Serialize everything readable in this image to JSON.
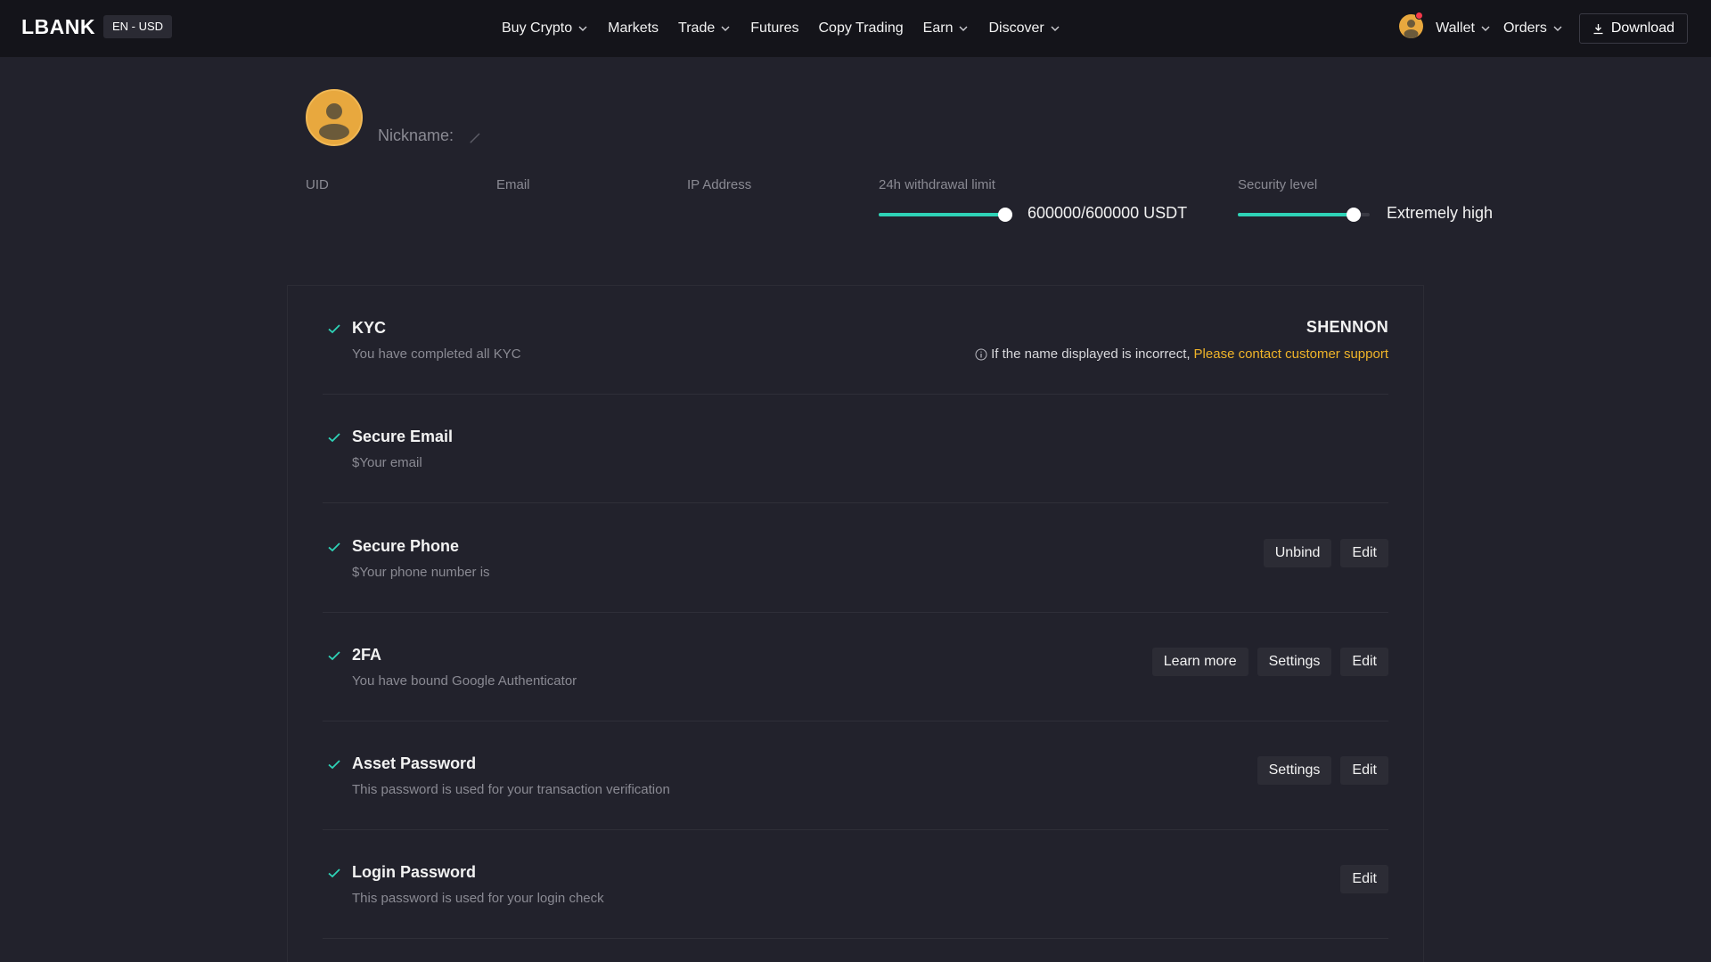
{
  "nav": {
    "logo": "LBANK",
    "lang_currency": "EN - USD",
    "items": [
      {
        "label": "Buy Crypto",
        "dropdown": true
      },
      {
        "label": "Markets",
        "dropdown": false
      },
      {
        "label": "Trade",
        "dropdown": true
      },
      {
        "label": "Futures",
        "dropdown": false
      },
      {
        "label": "Copy Trading",
        "dropdown": false
      },
      {
        "label": "Earn",
        "dropdown": true
      },
      {
        "label": "Discover",
        "dropdown": true
      }
    ],
    "wallet": "Wallet",
    "orders": "Orders",
    "download": "Download"
  },
  "profile": {
    "nickname_label": "Nickname:",
    "uid_label": "UID",
    "email_label": "Email",
    "ip_label": "IP Address",
    "withdrawal_label": "24h withdrawal limit",
    "withdrawal_value": "600000/600000 USDT",
    "withdrawal_fraction": 1.0,
    "security_label": "Security level",
    "security_value": "Extremely high",
    "security_fraction": 0.88
  },
  "security": {
    "kyc": {
      "title": "KYC",
      "desc": "You have completed all KYC",
      "name": "SHENNON",
      "note": "If the name displayed is incorrect,",
      "support_link": "Please contact customer support"
    },
    "email": {
      "title": "Secure Email",
      "desc": "$Your email"
    },
    "phone": {
      "title": "Secure Phone",
      "desc": "$Your phone number is",
      "unbind": "Unbind",
      "edit": "Edit"
    },
    "twofa": {
      "title": "2FA",
      "desc": "You have bound Google Authenticator",
      "learn_more": "Learn more",
      "settings": "Settings",
      "edit": "Edit"
    },
    "asset_password": {
      "title": "Asset Password",
      "desc": "This password is used for your transaction verification",
      "settings": "Settings",
      "edit": "Edit"
    },
    "login_password": {
      "title": "Login Password",
      "desc": "This password is used for your login check",
      "edit": "Edit"
    }
  },
  "colors": {
    "background": "#22222c",
    "nav_background": "#14141a",
    "accent_teal": "#2ed3b7",
    "link_gold": "#f0b429",
    "avatar_gold": "#e8a83e",
    "notification_red": "#f5384a"
  }
}
